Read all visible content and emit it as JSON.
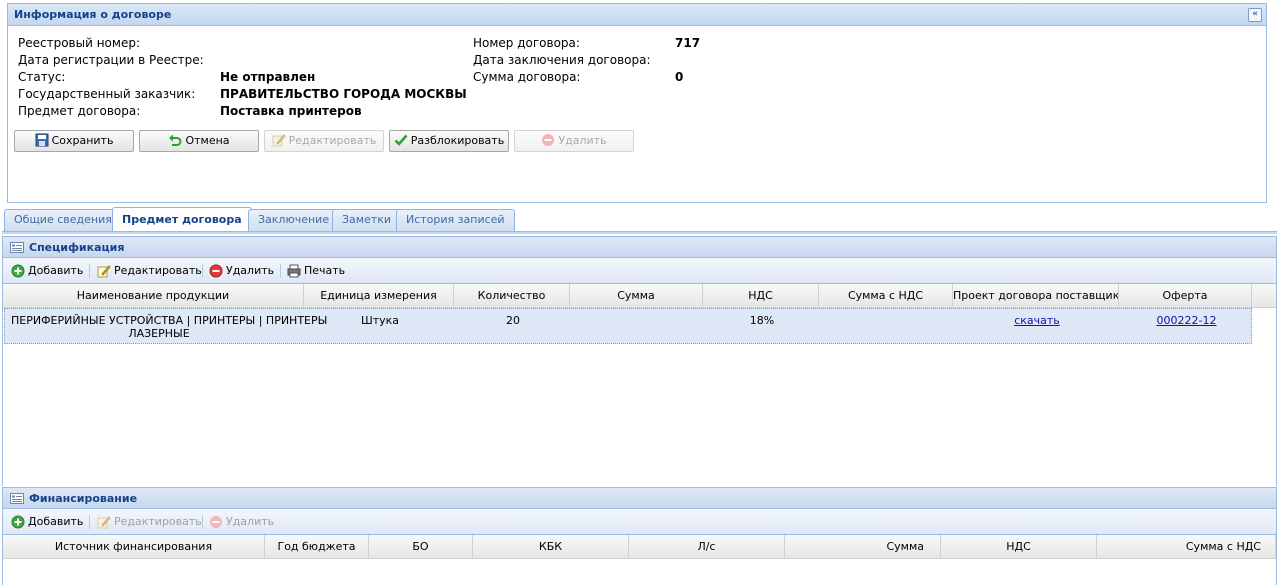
{
  "info_panel": {
    "title": "Информация о договоре",
    "collapse_symbol": "«",
    "left_fields": [
      {
        "label": "Реестровый номер:",
        "value": ""
      },
      {
        "label": "Дата регистрации в Реестре:",
        "value": ""
      },
      {
        "label": "Статус:",
        "value": "Не отправлен"
      },
      {
        "label": "Государственный заказчик:",
        "value": "ПРАВИТЕЛЬСТВО ГОРОДА МОСКВЫ"
      },
      {
        "label": "Предмет договора:",
        "value": "Поставка принтеров"
      }
    ],
    "right_fields": [
      {
        "label": "Номер договора:",
        "value": "717"
      },
      {
        "label": "Дата заключения договора:",
        "value": ""
      },
      {
        "label": "Сумма договора:",
        "value": "0"
      }
    ],
    "buttons": [
      {
        "label": "Сохранить",
        "icon": "save-icon",
        "disabled": false
      },
      {
        "label": "Отмена",
        "icon": "undo-icon",
        "disabled": false
      },
      {
        "label": "Редактировать",
        "icon": "edit-icon",
        "disabled": true
      },
      {
        "label": "Разблокировать",
        "icon": "check-icon",
        "disabled": false
      },
      {
        "label": "Удалить",
        "icon": "delete-icon",
        "disabled": true
      }
    ]
  },
  "tabs": [
    {
      "label": "Общие сведения",
      "active": false
    },
    {
      "label": "Предмет договора",
      "active": true
    },
    {
      "label": "Заключение",
      "active": false
    },
    {
      "label": "Заметки",
      "active": false
    },
    {
      "label": "История записей",
      "active": false
    }
  ],
  "specification": {
    "title": "Спецификация",
    "toolbar": [
      {
        "label": "Добавить",
        "icon": "add-icon",
        "disabled": false
      },
      {
        "label": "Редактировать",
        "icon": "edit-icon",
        "disabled": false
      },
      {
        "label": "Удалить",
        "icon": "delete-icon",
        "disabled": false
      },
      {
        "label": "Печать",
        "icon": "print-icon",
        "disabled": false
      }
    ],
    "columns": [
      "Наименование продукции",
      "Единица измерения",
      "Количество",
      "Сумма",
      "НДС",
      "Сумма с НДС",
      "Проект договора поставщика",
      "Оферта"
    ],
    "rows": [
      {
        "name_line1": "ПЕРИФЕРИЙНЫЕ УСТРОЙСТВА | ПРИНТЕРЫ | ПРИНТЕРЫ",
        "name_line2": "ЛАЗЕРНЫЕ",
        "unit": "Штука",
        "quantity": "20",
        "sum": "",
        "vat": "18%",
        "sum_with_vat": "",
        "supplier_draft_link": "скачать",
        "offer_link": "000222-12"
      }
    ]
  },
  "financing": {
    "title": "Финансирование",
    "toolbar": [
      {
        "label": "Добавить",
        "icon": "add-icon",
        "disabled": false
      },
      {
        "label": "Редактировать",
        "icon": "edit-icon",
        "disabled": true
      },
      {
        "label": "Удалить",
        "icon": "delete-icon",
        "disabled": true
      }
    ],
    "columns": [
      "Источник финансирования",
      "Год бюджета",
      "БО",
      "КБК",
      "Л/с",
      "Сумма",
      "НДС",
      "Сумма с НДС"
    ]
  }
}
